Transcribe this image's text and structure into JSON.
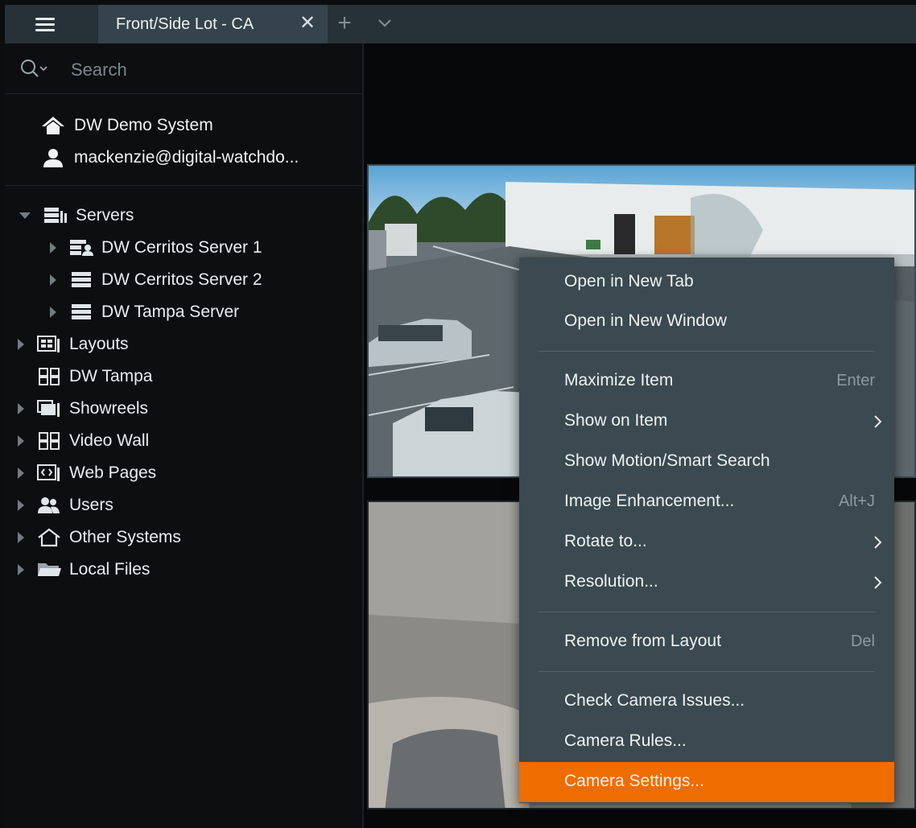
{
  "tabbar": {
    "tab_label": "Front/Side Lot - CA",
    "close_glyph": "✕",
    "add_glyph": "+"
  },
  "search": {
    "placeholder": "Search"
  },
  "system": {
    "name": "DW Demo System",
    "user": "mackenzie@digital-watchdo..."
  },
  "tree": {
    "servers": "Servers",
    "server1": "DW Cerritos Server 1",
    "server2": "DW Cerritos Server 2",
    "server3": "DW Tampa Server",
    "layouts": "Layouts",
    "dw_tampa": "DW Tampa",
    "showreels": "Showreels",
    "video_wall": "Video Wall",
    "web_pages": "Web Pages",
    "users": "Users",
    "other_systems": "Other Systems",
    "local_files": "Local Files"
  },
  "context_menu": {
    "open_new_tab": "Open in New Tab",
    "open_new_window": "Open in New Window",
    "maximize": "Maximize Item",
    "maximize_shortcut": "Enter",
    "show_on_item": "Show on Item",
    "motion_search": "Show Motion/Smart Search",
    "image_enhancement": "Image Enhancement...",
    "image_enhancement_shortcut": "Alt+J",
    "rotate": "Rotate to...",
    "resolution": "Resolution...",
    "remove": "Remove from Layout",
    "remove_shortcut": "Del",
    "check_issues": "Check Camera Issues...",
    "camera_rules": "Camera Rules...",
    "camera_settings": "Camera Settings..."
  },
  "colors": {
    "accent": "#ef6c00",
    "tab_bar": "#263238",
    "menu_bg": "#3b4950",
    "panel_bg": "#0c0e10"
  },
  "icons": [
    "hamburger-icon",
    "close-icon",
    "plus-icon",
    "chevron-down-icon",
    "search-icon",
    "home-icon",
    "user-icon",
    "server-group-icon",
    "server-icon",
    "layout-icon",
    "grid-icon",
    "showreel-icon",
    "web-page-icon",
    "users-icon",
    "other-systems-icon",
    "folder-icon",
    "chevron-right-icon"
  ]
}
